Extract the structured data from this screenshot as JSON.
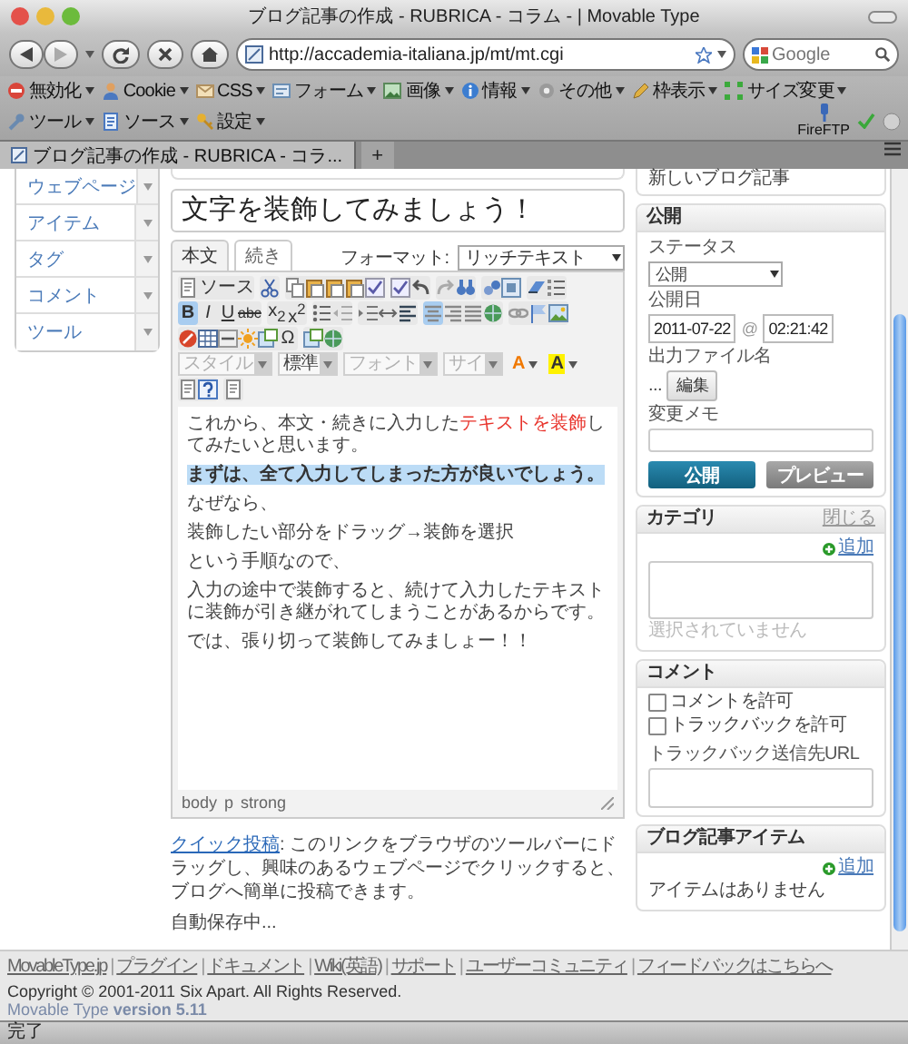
{
  "window": {
    "title": "ブログ記事の作成 - RUBRICA - コラム - | Movable Type"
  },
  "navigation": {
    "url": "http://accademia-italiana.jp/mt/mt.cgi",
    "search": {
      "placeholder": "Google"
    }
  },
  "dev_toolbar": {
    "items": [
      "無効化",
      "Cookie",
      "CSS",
      "フォーム",
      "画像",
      "情報",
      "その他",
      "枠表示",
      "サイズ変更",
      "ツール",
      "ソース",
      "設定"
    ],
    "fireftp": "FireFTP"
  },
  "tabs": [
    {
      "label": "ブログ記事の作成 - RUBRICA - コラ...",
      "selected": true
    }
  ],
  "new_tab": "+",
  "sidebar": {
    "items": [
      "ウェブページ",
      "アイテム",
      "タグ",
      "コメント",
      "ツール"
    ]
  },
  "entry": {
    "title": "文字を装飾してみましょう！",
    "tabs": [
      {
        "label": "本文",
        "selected": true
      },
      {
        "label": "続き",
        "selected": false
      }
    ],
    "format_label": "フォーマット:",
    "format": "リッチテキスト",
    "toolbar": [
      [
        [
          {
            "kind": "source",
            "label": "ソース",
            "active": false
          }
        ],
        [
          {
            "kind": "icon",
            "active": false
          }
        ],
        [
          {
            "kind": "icon",
            "active": false
          },
          {
            "kind": "icon",
            "active": false
          },
          {
            "kind": "icon",
            "active": false
          },
          {
            "kind": "icon",
            "active": false
          },
          {
            "kind": "icon",
            "active": false
          }
        ],
        [
          {
            "kind": "icon",
            "active": false
          },
          {
            "kind": "icon",
            "active": false
          }
        ],
        [
          {
            "kind": "icon",
            "active": false
          },
          {
            "kind": "icon",
            "active": false
          }
        ],
        [
          {
            "kind": "icon",
            "active": false
          },
          {
            "kind": "icon",
            "active": false
          }
        ],
        [
          {
            "kind": "icon",
            "active": false
          },
          {
            "kind": "icon",
            "active": false
          }
        ]
      ],
      [
        [
          {
            "kind": "bold",
            "label": "B",
            "active": true
          },
          {
            "kind": "italic",
            "label": "I",
            "active": false
          },
          {
            "kind": "underline",
            "label": "U",
            "active": false
          },
          {
            "kind": "strike",
            "label": "abc",
            "active": false
          }
        ],
        [
          {
            "kind": "text",
            "label": "x$_{2}$",
            "active": false
          },
          {
            "kind": "text",
            "label": "x$^{2}$",
            "active": false
          }
        ],
        [
          {
            "kind": "icon",
            "active": false
          },
          {
            "kind": "icon",
            "active": false
          }
        ],
        [
          {
            "kind": "icon",
            "active": false
          },
          {
            "kind": "icon",
            "active": false
          },
          {
            "kind": "icon",
            "active": false
          }
        ],
        [
          {
            "kind": "icon",
            "active": true
          },
          {
            "kind": "icon",
            "active": false
          },
          {
            "kind": "icon",
            "active": false
          },
          {
            "kind": "icon",
            "active": false
          }
        ],
        [
          {
            "kind": "icon",
            "active": false
          },
          {
            "kind": "icon",
            "active": false
          },
          {
            "kind": "icon",
            "active": false
          }
        ]
      ],
      [
        [
          {
            "kind": "icon",
            "active": false
          },
          {
            "kind": "icon",
            "active": false
          },
          {
            "kind": "icon",
            "active": false
          },
          {
            "kind": "icon",
            "active": false
          },
          {
            "kind": "icon",
            "active": false
          },
          {
            "kind": "text",
            "label": "Ω",
            "active": false
          }
        ],
        [
          {
            "kind": "icon",
            "active": false
          },
          {
            "kind": "icon",
            "active": false
          }
        ]
      ],
      [
        [
          {
            "kind": "dropdown",
            "label": "スタイル",
            "disabled": true
          }
        ],
        [
          {
            "kind": "dropdown",
            "label": "標準",
            "disabled": false
          }
        ],
        [
          {
            "kind": "dropdown",
            "label": "フォント",
            "disabled": true
          }
        ],
        [
          {
            "kind": "dropdown",
            "label": "サイ",
            "disabled": true
          }
        ],
        [
          {
            "kind": "font-color",
            "label": "A",
            "color": "#f07800"
          },
          {
            "kind": "back-color",
            "label": "A",
            "color": "#fff200"
          }
        ]
      ],
      [
        [
          {
            "kind": "icon",
            "active": false
          },
          {
            "kind": "icon",
            "active": false
          }
        ],
        [
          {
            "kind": "icon",
            "active": false
          }
        ]
      ]
    ],
    "paragraphs": [
      {
        "runs": [
          {
            "text": "これから、本文・続きに入力した",
            "kind": "plain"
          },
          {
            "text": "テキストを装飾",
            "kind": "red"
          },
          {
            "text": "してみたいと思います。",
            "kind": "plain"
          }
        ],
        "bold": false,
        "highlighted": false
      },
      {
        "runs": [
          {
            "text": "まずは、全て入力してしまった方が良いでしょう。",
            "kind": "plain"
          }
        ],
        "bold": true,
        "highlighted": true
      },
      {
        "runs": [
          {
            "text": "なぜなら、",
            "kind": "plain"
          }
        ],
        "bold": false,
        "highlighted": false
      },
      {
        "runs": [
          {
            "text": "装飾したい部分をドラッグ→装飾を選択",
            "kind": "plain"
          }
        ],
        "bold": false,
        "highlighted": false
      },
      {
        "runs": [
          {
            "text": "という手順なので、",
            "kind": "plain"
          }
        ],
        "bold": false,
        "highlighted": false
      },
      {
        "runs": [
          {
            "text": "入力の途中で装飾すると、続けて入力したテキストに装飾が引き継がれてしまうことがあるからです。",
            "kind": "plain"
          }
        ],
        "bold": false,
        "highlighted": false
      },
      {
        "runs": [
          {
            "text": "では、張り切って装飾してみましょー！！",
            "kind": "plain"
          }
        ],
        "bold": false,
        "highlighted": false
      }
    ],
    "element_path": [
      "body",
      "p",
      "strong"
    ],
    "quick_post": {
      "link": "クイック投稿",
      "text": ": このリンクをブラウザのツールバーにドラッグし、興味のあるウェブページでクリックすると、ブログへ簡単に投稿できます。"
    },
    "autosave": "自動保存中..."
  },
  "new_entry_card": {
    "text": "新しいブログ記事"
  },
  "publish": {
    "title": "公開",
    "status_label": "ステータス",
    "status": "公開",
    "date_label": "公開日",
    "date": "2011-07-22",
    "at": "@",
    "time": "02:21:42",
    "filename_label": "出力ファイル名",
    "filename": "...",
    "edit_button": "編集",
    "memo_label": "変更メモ",
    "publish_button": "公開",
    "preview_button": "プレビュー"
  },
  "category": {
    "title": "カテゴリ",
    "close_link": "閉じる",
    "add_link": "追加",
    "empty": "選択されていません"
  },
  "comments": {
    "title": "コメント",
    "options": [
      {
        "label": "コメントを許可",
        "checked": false
      },
      {
        "label": "トラックバックを許可",
        "checked": false
      }
    ],
    "trackback_label": "トラックバック送信先URL"
  },
  "entry_items": {
    "title": "ブログ記事アイテム",
    "add_link": "追加",
    "empty": "アイテムはありません"
  },
  "footer": {
    "links": [
      "MovableType.jp",
      "プラグイン",
      "ドキュメント",
      "Wiki(英語)",
      "サポート",
      "ユーザーコミュニティ",
      "フィードバックはこちらへ"
    ],
    "separator": "|",
    "copyright": "Copyright © 2001-2011 Six Apart. All Rights Reserved.",
    "version": "Movable Type **version 5.11**"
  },
  "status_bar": {
    "text": "完了"
  }
}
